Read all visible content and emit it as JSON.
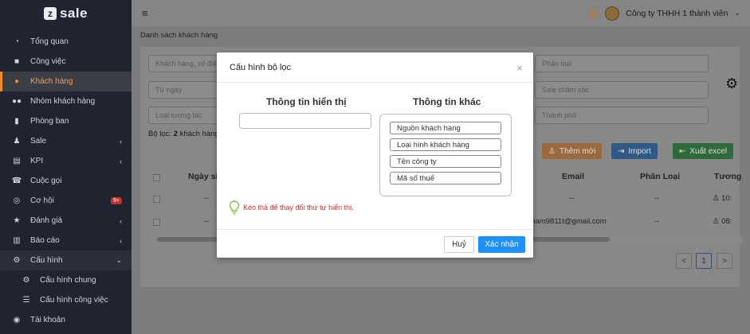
{
  "brand": {
    "logo_letter": "z",
    "logo_text": "sale"
  },
  "sidebar": {
    "items": [
      {
        "label": "Tổng quan",
        "icon": "dashboard-icon"
      },
      {
        "label": "Công việc",
        "icon": "briefcase-icon"
      },
      {
        "label": "Khách hàng",
        "icon": "user-icon",
        "active": true
      },
      {
        "label": "Nhóm khách hàng",
        "icon": "users-icon"
      },
      {
        "label": "Phòng ban",
        "icon": "building-icon"
      },
      {
        "label": "Sale",
        "icon": "sale-icon"
      },
      {
        "label": "KPI",
        "icon": "chart-icon"
      },
      {
        "label": "Cuộc gọi",
        "icon": "phone-icon"
      },
      {
        "label": "Cơ hội",
        "icon": "target-icon",
        "badge": "9+"
      },
      {
        "label": "Đánh giá",
        "icon": "star-icon"
      },
      {
        "label": "Báo cáo",
        "icon": "report-icon"
      },
      {
        "label": "Cấu hình",
        "icon": "cogs-icon"
      },
      {
        "label": "Cấu hình chung",
        "icon": "gear-icon"
      },
      {
        "label": "Cấu hình công việc",
        "icon": "list-icon"
      },
      {
        "label": "Tài khoản",
        "icon": "account-icon"
      }
    ]
  },
  "header": {
    "company": "Công ty THHH 1 thành viên"
  },
  "page": {
    "breadcrumb": "Danh sách khách hàng",
    "filters": {
      "search_placeholder": "Khách hàng, số điệ",
      "from_date": "Từ ngày",
      "interaction_type": "Loại tương tác",
      "category": "Phân loại",
      "sale_care": "Sale chăm sóc",
      "city": "Thành phố"
    },
    "filter_label": "Bộ lọc:",
    "filter_count": "2",
    "filter_suffix": "khách hàng",
    "buttons": {
      "add_new": "Thêm mới",
      "import": "Import",
      "export": "Xuất excel"
    },
    "columns": {
      "date": "Ngày si",
      "email": "Email",
      "category": "Phân Loại",
      "interaction": "Tương"
    },
    "rows": [
      {
        "dash1": "--",
        "email": "--",
        "category": "--",
        "time": "10:"
      },
      {
        "dash1": "--",
        "email": "pham9811t@gmail.com",
        "category": "--",
        "time": "08:"
      }
    ],
    "pagination": {
      "prev": "<",
      "current": "1",
      "next": ">"
    }
  },
  "modal": {
    "title": "Cấu hình bộ lọc",
    "close": "×",
    "left_title": "Thông tin hiển thị",
    "right_title": "Thông tin khác",
    "other_fields": [
      "Nguồn khách hàng",
      "Loại hình khách hàng",
      "Tên công ty",
      "Mã số thuế"
    ],
    "hint": "Kéo thả để thay đổi thứ tự hiển thị.",
    "cancel": "Huỷ",
    "confirm": "Xác nhận"
  },
  "colors": {
    "accent": "#f08a24",
    "primary": "#1e90ff",
    "hint": "#d7322b",
    "bulb": "#8bc34a"
  }
}
